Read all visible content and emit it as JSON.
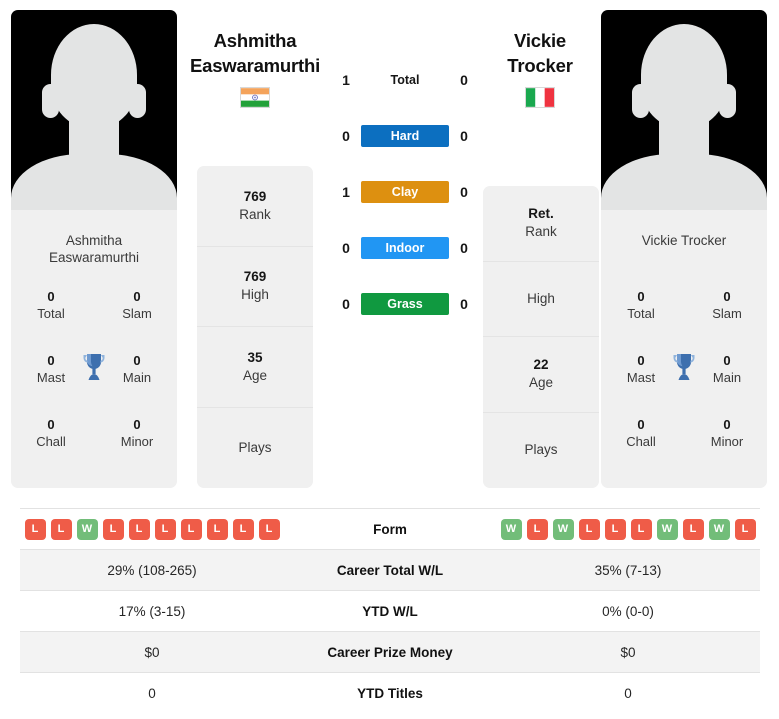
{
  "players": {
    "left": {
      "name": "Ashmitha Easwaramurthi",
      "name_line1": "Ashmitha",
      "name_line2": "Easwaramurthi",
      "photo_caption_line1": "Ashmitha",
      "photo_caption_line2": "Easwaramurthi",
      "country": "India",
      "flag_icon": "flag-india-icon",
      "info": [
        {
          "value": "769",
          "label": "Rank"
        },
        {
          "value": "769",
          "label": "High"
        },
        {
          "value": "35",
          "label": "Age"
        },
        {
          "value": "",
          "label": "Plays"
        }
      ],
      "titles": [
        {
          "value": "0",
          "label": "Total"
        },
        {
          "value": "0",
          "label": "Slam"
        },
        {
          "value": "0",
          "label": "Mast"
        },
        {
          "value": "0",
          "label": "Main"
        },
        {
          "value": "0",
          "label": "Chall"
        },
        {
          "value": "0",
          "label": "Minor"
        }
      ],
      "form": [
        "L",
        "L",
        "W",
        "L",
        "L",
        "L",
        "L",
        "L",
        "L",
        "L"
      ],
      "career_total_wl": "29% (108-265)",
      "ytd_wl": "17% (3-15)",
      "career_prize_money": "$0",
      "ytd_titles": "0"
    },
    "right": {
      "name": "Vickie Trocker",
      "name_line1": "Vickie",
      "name_line2": "Trocker",
      "photo_caption_line1": "Vickie Trocker",
      "photo_caption_line2": "",
      "country": "Italy",
      "flag_icon": "flag-italy-icon",
      "info": [
        {
          "value": "Ret.",
          "label": "Rank"
        },
        {
          "value": "",
          "label": "High"
        },
        {
          "value": "22",
          "label": "Age"
        },
        {
          "value": "",
          "label": "Plays"
        }
      ],
      "titles": [
        {
          "value": "0",
          "label": "Total"
        },
        {
          "value": "0",
          "label": "Slam"
        },
        {
          "value": "0",
          "label": "Mast"
        },
        {
          "value": "0",
          "label": "Main"
        },
        {
          "value": "0",
          "label": "Chall"
        },
        {
          "value": "0",
          "label": "Minor"
        }
      ],
      "form": [
        "W",
        "L",
        "W",
        "L",
        "L",
        "L",
        "W",
        "L",
        "W",
        "L"
      ],
      "career_total_wl": "35% (7-13)",
      "ytd_wl": "0% (0-0)",
      "career_prize_money": "$0",
      "ytd_titles": "0"
    }
  },
  "head_to_head": {
    "rows": [
      {
        "label": "Total",
        "left": "1",
        "right": "0",
        "color": "",
        "has_bar": false
      },
      {
        "label": "Hard",
        "left": "0",
        "right": "0",
        "color": "#0c6fc0",
        "has_bar": true
      },
      {
        "label": "Clay",
        "left": "1",
        "right": "0",
        "color": "#dd9010",
        "has_bar": true
      },
      {
        "label": "Indoor",
        "left": "0",
        "right": "0",
        "color": "#2196f3",
        "has_bar": true
      },
      {
        "label": "Grass",
        "left": "0",
        "right": "0",
        "color": "#109940",
        "has_bar": true
      }
    ]
  },
  "table": {
    "rows": [
      {
        "label": "Form",
        "type": "form"
      },
      {
        "label": "Career Total W/L",
        "type": "text",
        "key": "career_total_wl"
      },
      {
        "label": "YTD W/L",
        "type": "text",
        "key": "ytd_wl"
      },
      {
        "label": "Career Prize Money",
        "type": "text",
        "key": "career_prize_money"
      },
      {
        "label": "YTD Titles",
        "type": "text",
        "key": "ytd_titles"
      }
    ]
  },
  "icons": {
    "trophy": "trophy-icon",
    "avatar_placeholder": "avatar-placeholder-icon"
  },
  "colors": {
    "win": "#72bd79",
    "loss": "#ef5c48",
    "card_bg": "#f0f0f0",
    "row_shade": "#f3f3f3"
  }
}
